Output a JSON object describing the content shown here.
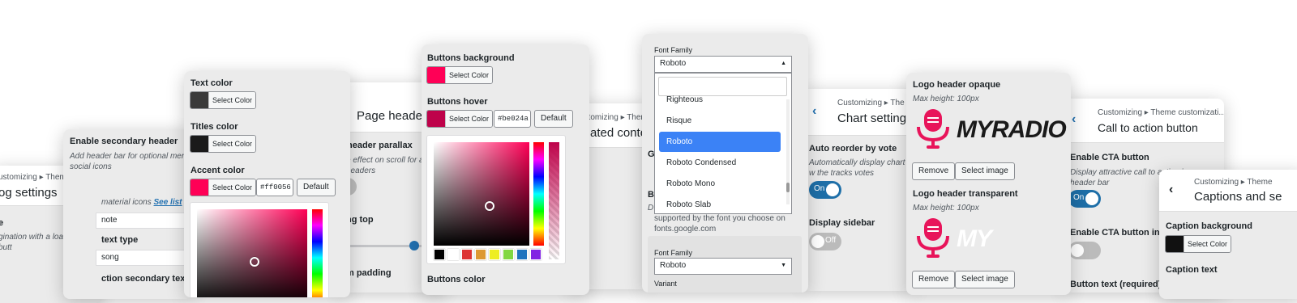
{
  "colors": {
    "accent": "#ff0056",
    "buttons_hover": "#be024a",
    "blue": "#2271b1",
    "select": "#3b82f6",
    "text_color": "#3a3a3a",
    "titles_color": "#1a1a1a",
    "mic": "#e8145a"
  },
  "p1": {
    "breadcrumb": "ustomizing ▸ Theme customiza",
    "title": "og settings",
    "items": [
      "e",
      "gination with a load more butt"
    ]
  },
  "p2": {
    "enable_label": "Enable secondary header",
    "desc": "Add header bar for optional menu social icons",
    "material": "material icons",
    "see_list": "See list",
    "f1": "note",
    "text_type": "text type",
    "f2": "song",
    "section_text": "ction secondary text"
  },
  "p3": {
    "text_color": "Text color",
    "titles_color": "Titles color",
    "accent_color": "Accent color",
    "select": "Select Color",
    "hex": "#ff0056",
    "default": "Default"
  },
  "p4": {
    "crumb": "…",
    "title": "Page headers",
    "parallax": "header parallax",
    "parallax_desc": "e effect on scroll for an t headers",
    "toggle": "ff",
    "ng_top": "ng top",
    "m_padding": "m padding"
  },
  "p5": {
    "bg_label": "Buttons background",
    "hover_label": "Buttons hover",
    "color_label": "Buttons color",
    "select": "Select Color",
    "hex": "#be024a",
    "default": "Default"
  },
  "p6": {
    "crumb": "ustomizing ▸ Theme",
    "title": "ated conte"
  },
  "p7": {
    "ff_label": "Font Family",
    "value": "Roboto",
    "options": [
      "Righteous",
      "Risque",
      "Roboto",
      "Roboto Condensed",
      "Roboto Mono",
      "Roboto Slab"
    ],
    "g_label": "G",
    "b_label": "B",
    "desc_line1": "D",
    "desc_line2": "supported by the font you choose on",
    "desc_line3": "fonts.google.com",
    "ff_label2": "Font Family",
    "value2": "Roboto",
    "variant": "Variant"
  },
  "p8": {
    "crumb": "Customizing ▸ The",
    "title": "Chart settings",
    "reorder": "Auto reorder by vote",
    "reorder_desc": "Automatically display chart w the tracks votes",
    "on": "On",
    "sidebar": "Display sidebar",
    "off": "Off"
  },
  "p9": {
    "opaque": "Logo header opaque",
    "transparent": "Logo header transparent",
    "max": "Max height: 100px",
    "logo1": "MYRADIO",
    "logo2": "MY",
    "remove": "Remove",
    "select_image": "Select image"
  },
  "p10": {
    "crumb": "Customizing ▸ Theme customizati...",
    "title": "Call to action button",
    "enable": "Enable CTA button",
    "desc": "Display attractive call to action in header bar",
    "on": "On",
    "enable_m": "Enable CTA button in m",
    "text_req": "Button text (required)"
  },
  "p11": {
    "crumb": "Customizing ▸ Theme",
    "title": "Captions and se",
    "cap_bg": "Caption background",
    "select": "Select Color",
    "cap_text": "Caption text"
  }
}
